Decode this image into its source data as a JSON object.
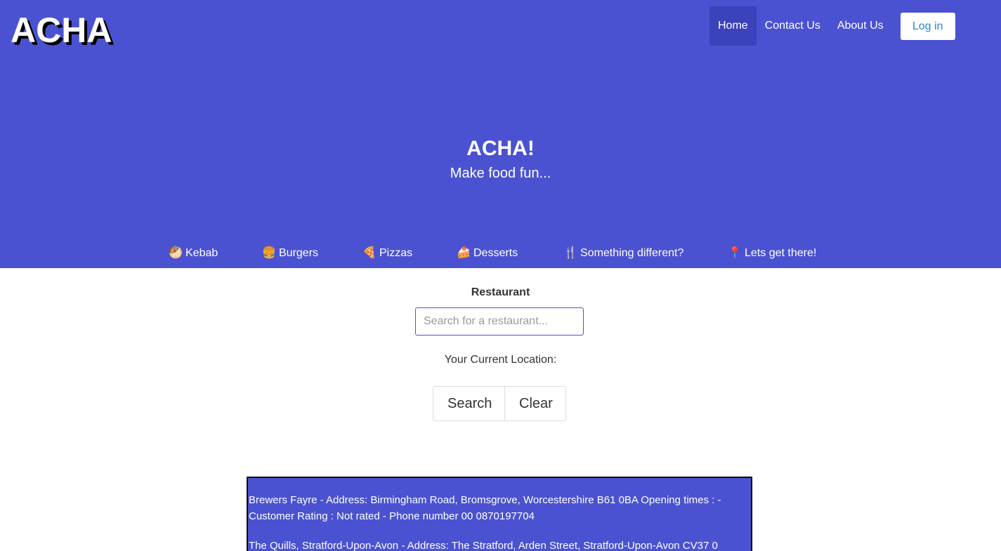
{
  "brand": {
    "logo": "ACHA"
  },
  "nav": {
    "items": [
      {
        "label": "Home",
        "active": true
      },
      {
        "label": "Contact Us",
        "active": false
      },
      {
        "label": "About Us",
        "active": false
      }
    ],
    "login_label": "Log in"
  },
  "hero": {
    "title": "ACHA!",
    "subtitle": "Make food fun..."
  },
  "categories": [
    {
      "emoji": "🥙",
      "label": "Kebab"
    },
    {
      "emoji": "🍔",
      "label": "Burgers"
    },
    {
      "emoji": "🍕",
      "label": "Pizzas"
    },
    {
      "emoji": "🍰",
      "label": "Desserts"
    },
    {
      "emoji": "🍴",
      "label": "Something different?"
    },
    {
      "emoji": "📍",
      "label": "Lets get there!"
    }
  ],
  "search": {
    "label": "Restaurant",
    "placeholder": "Search for a restaurant...",
    "value": "",
    "location_label": "Your Current Location:",
    "search_button": "Search",
    "clear_button": "Clear"
  },
  "results": [
    "Brewers Fayre - Address: Birmingham Road, Bromsgrove, Worcestershire B61 0BA Opening times : - Customer Rating : Not rated - Phone number 00 0870197704",
    "The Quills, Stratford-Upon-Avon - Address: The Stratford, Arden Street, Stratford-Upon-Avon CV37 0"
  ],
  "colors": {
    "primary": "#4b52d1",
    "nav_active": "#3b42bb",
    "login_text": "#2a86d6"
  }
}
